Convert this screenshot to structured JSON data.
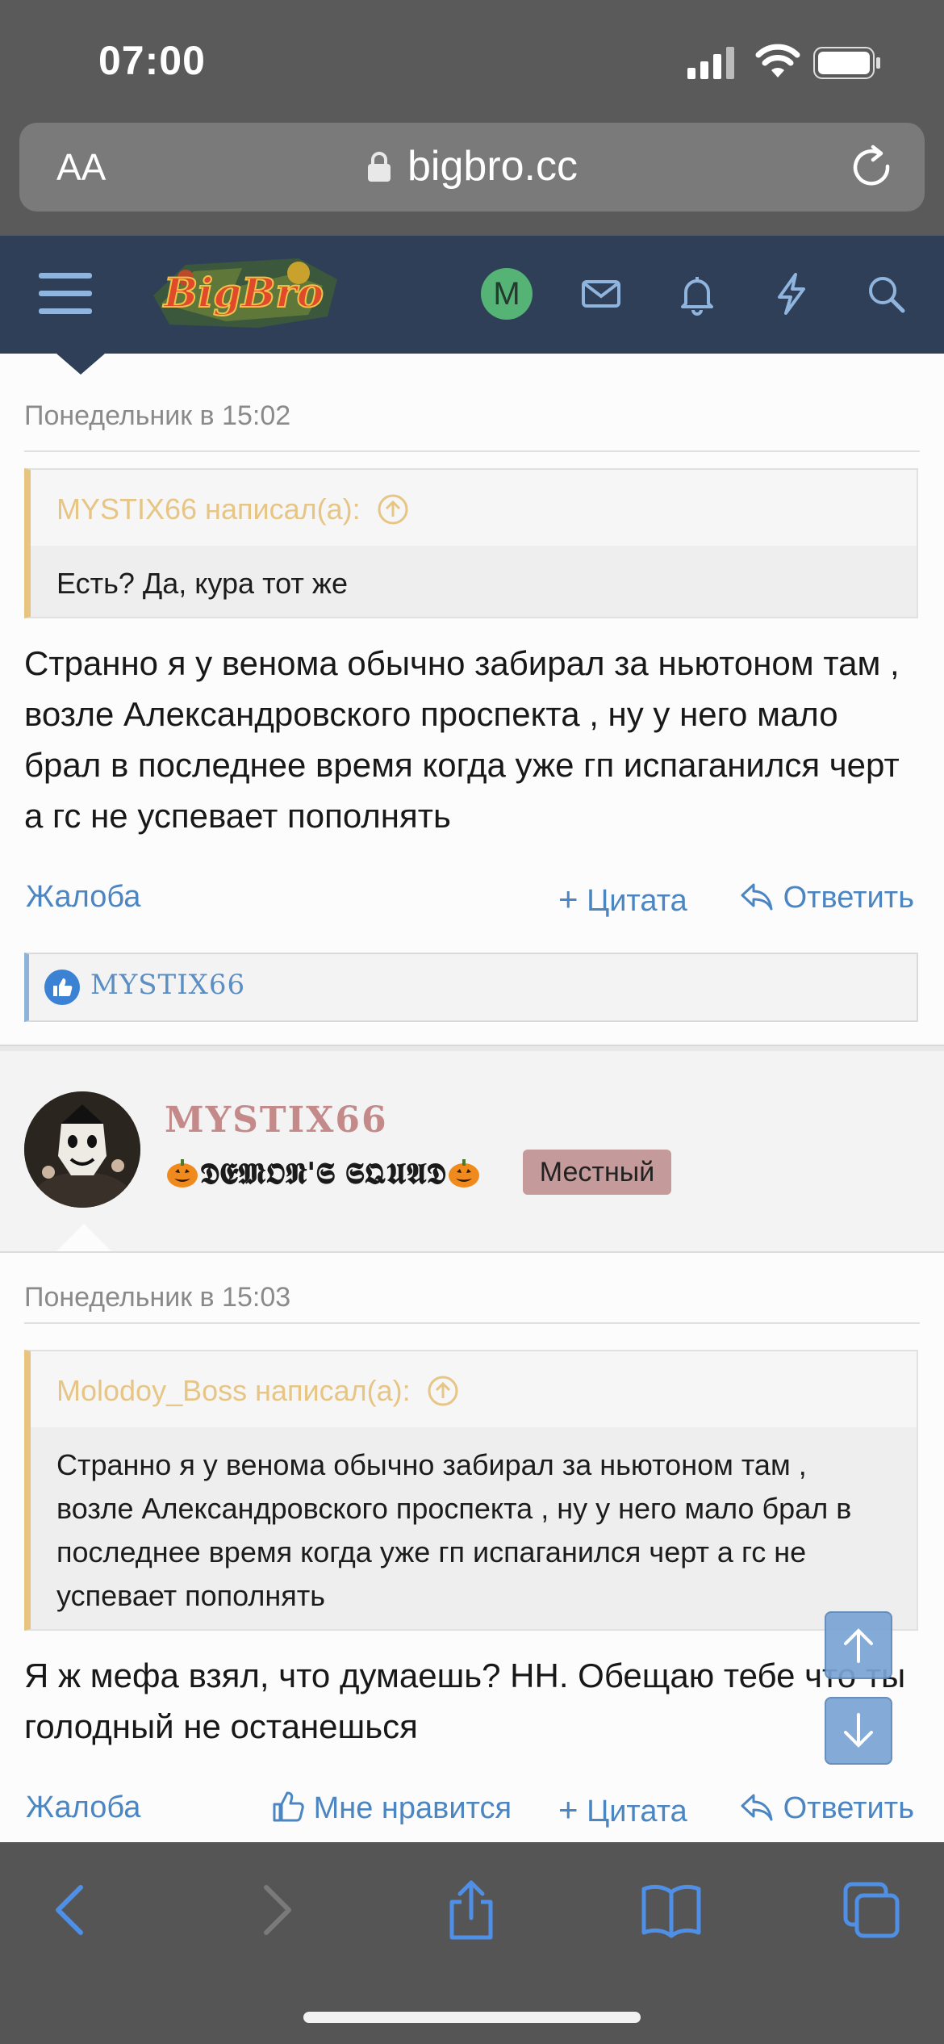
{
  "status": {
    "time": "07:00"
  },
  "browser": {
    "aa": "AA",
    "url": "bigbro.cc"
  },
  "site": {
    "logo_text": "BigBro",
    "user_initial": "M"
  },
  "post1": {
    "date": "Понедельник в 15:02",
    "quote_author": "MYSTIX66 написал(а):",
    "quote_text": "Есть? Да, кура тот же",
    "message": "Странно я у венома обычно забирал за ньютоном там , возле Александровского проспекта , ну у него мало брал в последнее время когда уже гп испаганился черт а гс не успевает пополнять",
    "actions": {
      "report": "Жалоба",
      "quote": "Цитата",
      "reply": "Ответить"
    },
    "reaction_user": "MYSTIX66"
  },
  "post2": {
    "username": "MYSTIX66",
    "user_title": "𝕯𝕰𝕸𝕺𝕹'𝕾 𝕾𝕼𝖀𝕬𝕯",
    "badge": "Местный",
    "date": "Понедельник в 15:03",
    "quote_author": "Molodoy_Boss написал(а):",
    "quote_text": "Странно я у венома обычно забирал за ньютоном там , возле Александровского проспекта , ну у него мало брал в последнее время когда уже гп испаганился черт а гс не успевает пополнять",
    "message": "Я ж мефа взял, что думаешь? НН. Обещаю тебе что ты голодный не останешься",
    "actions": {
      "report": "Жалоба",
      "like": "Мне нравится",
      "quote": "Цитата",
      "reply": "Ответить"
    }
  },
  "colors": {
    "nav": "#2f3f58",
    "link": "#4b86c3",
    "quote_accent": "#e7c47f",
    "username": "#c48a8a"
  }
}
